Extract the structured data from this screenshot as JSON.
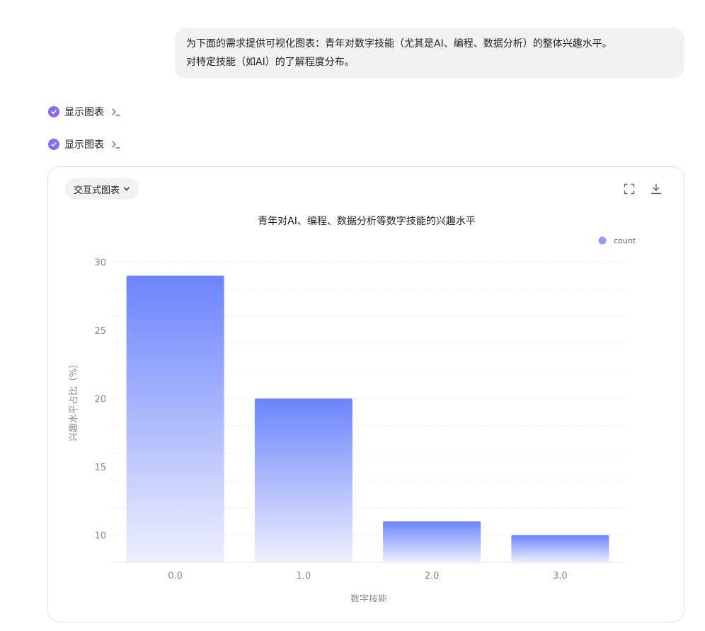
{
  "user_message": {
    "line1": "为下面的需求提供可视化图表：青年对数字技能（尤其是AI、编程、数据分析）的整体兴趣水平。",
    "line2": "对特定技能（如AI）的了解程度分布。"
  },
  "steps": [
    {
      "label": "显示图表",
      "icon": "check-circle-icon",
      "action_icon": "terminal-icon"
    },
    {
      "label": "显示图表",
      "icon": "check-circle-icon",
      "action_icon": "terminal-icon"
    }
  ],
  "chart_card": {
    "type_button_label": "交互式图表",
    "type_button_icon": "chevron-down-icon",
    "fullscreen_icon": "fullscreen-icon",
    "download_icon": "download-icon"
  },
  "colors": {
    "accent": "#8b6cf0",
    "bar_top": "#6b84fc",
    "bar_bottom": "#eef0fe"
  },
  "chart_data": {
    "type": "bar",
    "title": "青年对AI、编程、数据分析等数字技能的兴趣水平",
    "xlabel": "数字技能",
    "ylabel": "兴趣水平占比（%）",
    "categories": [
      "0.0",
      "1.0",
      "2.0",
      "3.0"
    ],
    "series": [
      {
        "name": "count",
        "values": [
          29,
          20,
          11,
          10
        ]
      }
    ],
    "ylim": [
      8,
      31
    ],
    "yticks": [
      10,
      15,
      20,
      25,
      30
    ],
    "legend_position": "top-right",
    "grid": "horizontal-dashed"
  }
}
